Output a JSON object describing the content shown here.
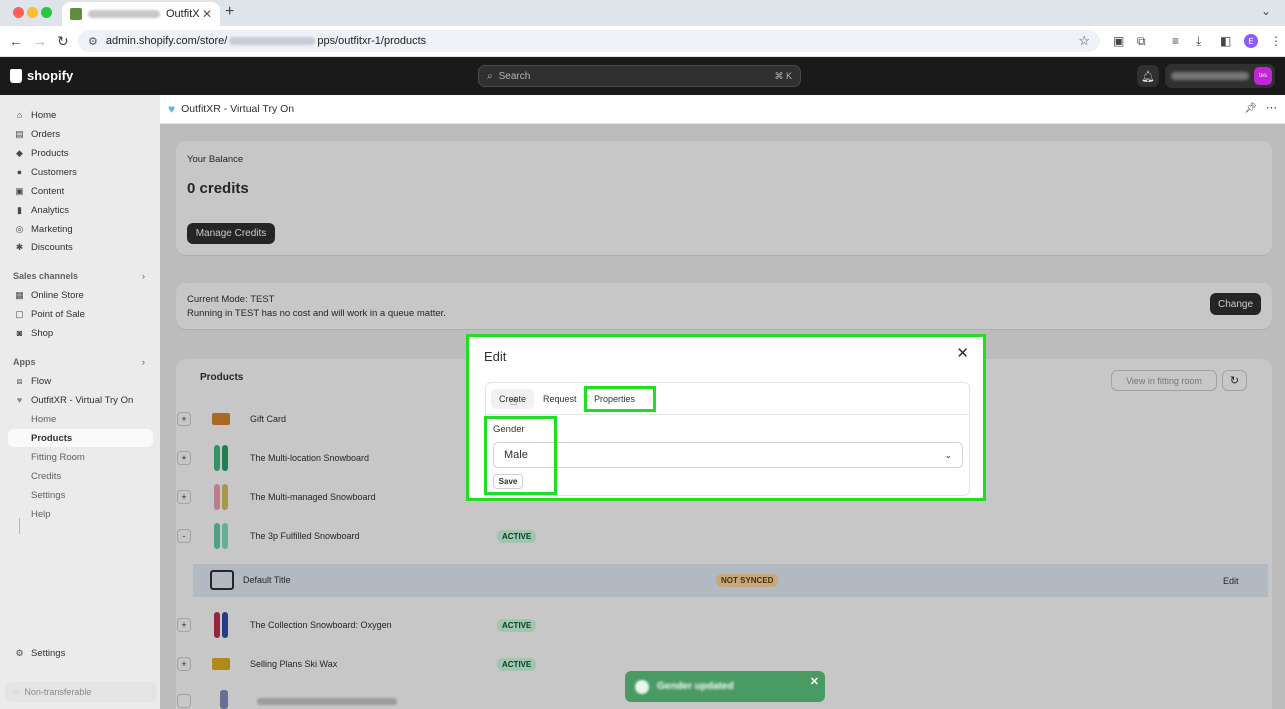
{
  "browser": {
    "tab_title": "OutfitX",
    "url_prefix": "admin.shopify.com/store/",
    "url_suffix": "pps/outfitxr-1/products",
    "avatar_letter": "E"
  },
  "topbar": {
    "logo": "shopify",
    "search_placeholder": "Search",
    "search_shortcut": "⌘ K",
    "store_avatar": "tes"
  },
  "sidebar": {
    "main": [
      "Home",
      "Orders",
      "Products",
      "Customers",
      "Content",
      "Analytics",
      "Marketing",
      "Discounts"
    ],
    "sales_channels_title": "Sales channels",
    "sales_channels": [
      "Online Store",
      "Point of Sale",
      "Shop"
    ],
    "apps_title": "Apps",
    "apps": [
      "Flow",
      "OutfitXR - Virtual Try On"
    ],
    "app_sub": [
      "Home",
      "Products",
      "Fitting Room",
      "Credits",
      "Settings",
      "Help"
    ],
    "settings": "Settings",
    "non_transferable": "Non-transferable"
  },
  "app_header": {
    "title": "OutfitXR - Virtual Try On"
  },
  "balance": {
    "label": "Your Balance",
    "value": "0 credits",
    "button": "Manage Credits"
  },
  "mode": {
    "title": "Current Mode: TEST",
    "desc": "Running in TEST has no cost and will work in a queue matter.",
    "button": "Change"
  },
  "products": {
    "title": "Products",
    "view_button": "View in fitting room",
    "rows": [
      {
        "expander": "+",
        "name": "Gift Card",
        "status": ""
      },
      {
        "expander": "+",
        "name": "The Multi-location Snowboard",
        "status": ""
      },
      {
        "expander": "+",
        "name": "The Multi-managed Snowboard",
        "status": ""
      },
      {
        "expander": "-",
        "name": "The 3p Fulfilled Snowboard",
        "status": "ACTIVE"
      },
      {
        "expander": "+",
        "name": "The Collection Snowboard: Oxygen",
        "status": "ACTIVE"
      },
      {
        "expander": "+",
        "name": "Selling Plans Ski Wax",
        "status": "ACTIVE"
      }
    ],
    "variant": {
      "name": "Default Title",
      "status": "NOT SYNCED",
      "action": "Edit"
    }
  },
  "modal": {
    "title": "Edit",
    "tabs": [
      "Create",
      "Request",
      "Properties"
    ],
    "gender_label": "Gender",
    "gender_value": "Male",
    "save": "Save"
  },
  "toast": {
    "text": "Gender updated"
  },
  "colors": {
    "highlight": "#22dd22",
    "topbar": "#1a1a1a",
    "active_badge": "#cdfee1",
    "not_synced_badge": "#ffd6a4",
    "toast": "#4a9a63"
  }
}
